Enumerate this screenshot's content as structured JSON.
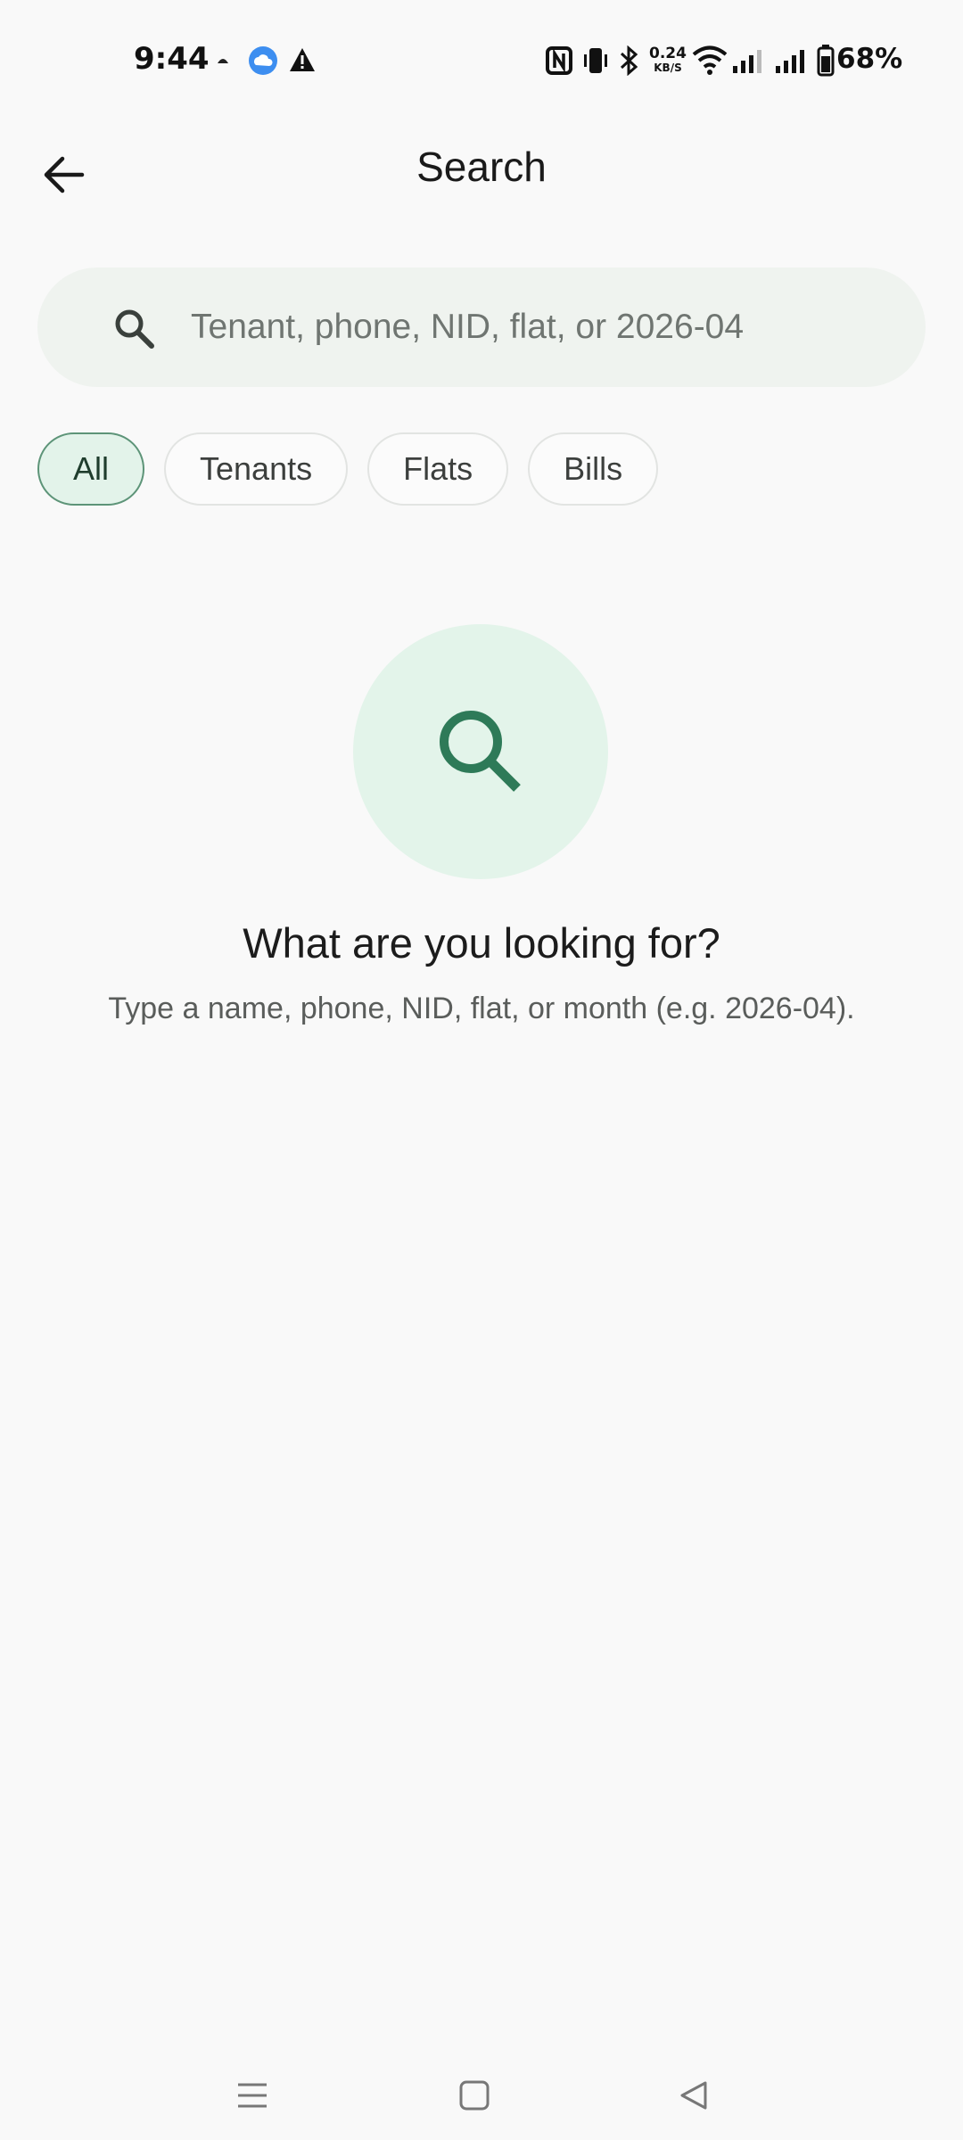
{
  "status_bar": {
    "time": "9:44",
    "net_speed_value": "0.24",
    "net_speed_unit": "KB/S",
    "battery": "68%",
    "icons": [
      "notification-dot-icon",
      "weather-cloud-icon",
      "warning-icon",
      "nfc-icon",
      "vibrate-icon",
      "bluetooth-icon",
      "wifi-icon",
      "signal-icon",
      "signal-icon",
      "battery-icon"
    ]
  },
  "header": {
    "title": "Search",
    "back_icon": "arrow-left-icon"
  },
  "search": {
    "placeholder": "Tenant, phone, NID, flat, or 2026-04",
    "value": "",
    "icon": "search-icon"
  },
  "filters": {
    "chips": [
      {
        "label": "All",
        "selected": true
      },
      {
        "label": "Tenants",
        "selected": false
      },
      {
        "label": "Flats",
        "selected": false
      },
      {
        "label": "Bills",
        "selected": false
      }
    ]
  },
  "empty_state": {
    "icon": "search-icon",
    "title": "What are you looking for?",
    "subtitle": "Type a name, phone, NID, flat, or month (e.g. 2026-04)."
  },
  "nav_bar": {
    "buttons": [
      "menu-icon",
      "home-square-icon",
      "back-triangle-icon"
    ]
  },
  "colors": {
    "background": "#f9f9f9",
    "search_field_bg": "#eff3ef",
    "accent_green": "#2e7a58",
    "chip_selected_bg": "#e3f3ea",
    "empty_circle_bg": "#e3f4ea"
  }
}
